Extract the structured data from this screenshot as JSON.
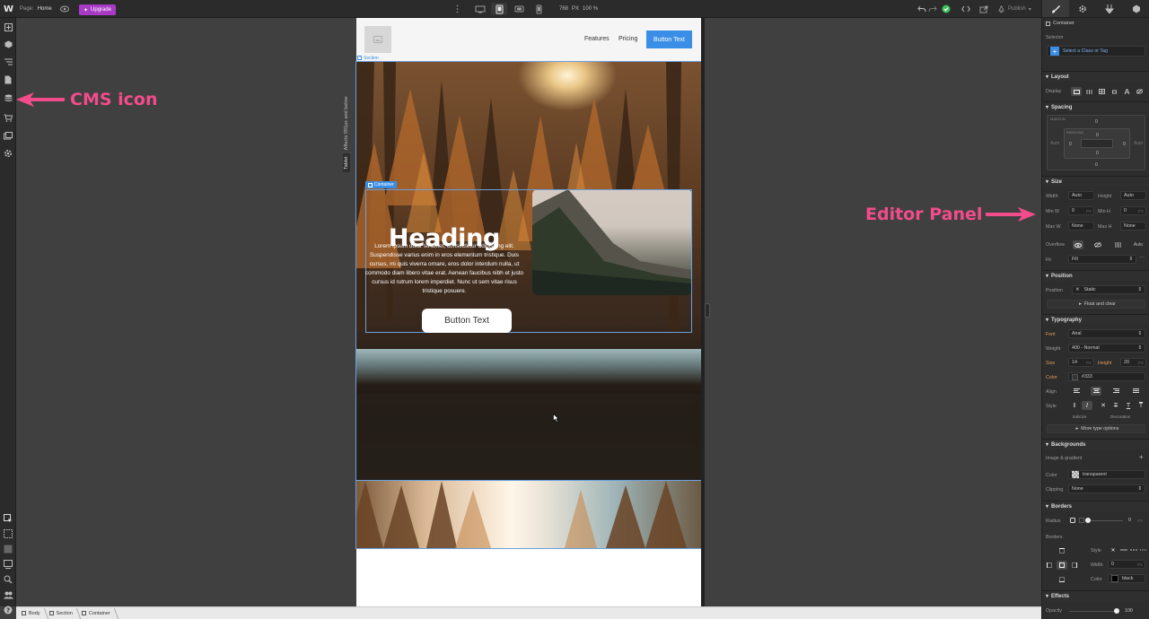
{
  "topbar": {
    "logo": "W",
    "page_label": "Page:",
    "page_value": "Home",
    "upgrade_label": "Upgrade",
    "width_readout": "768",
    "width_unit": "PX",
    "zoom_readout": "100 %",
    "publish_label": "Publish"
  },
  "canvas": {
    "breakpoint_note": "Affects 991px and below",
    "breakpoint_tag": "Tablet",
    "site": {
      "nav_links": [
        "Features",
        "Pricing"
      ],
      "nav_button": "Button Text",
      "section_tag": "Section",
      "container_tag": "Container",
      "heading": "Heading",
      "paragraph": "Lorem ipsum dolor sit amet, consectetur adipiscing elit. Suspendisse varius enim in eros elementum tristique. Duis cursus, mi quis viverra ornare, eros dolor interdum nulla, ut commodo diam libero vitae erat. Aenean faucibus nibh et justo cursus id rutrum lorem imperdiet. Nunc ut sem vitae risus tristique posuere.",
      "hero_button": "Button Text"
    },
    "callout_cms": "CMS icon",
    "callout_panel": "Editor Panel"
  },
  "panel": {
    "element_name": "Container",
    "selector_label": "Selector",
    "selector_placeholder": "Select a Class or Tag",
    "layout": {
      "title": "Layout",
      "display_label": "Display"
    },
    "spacing": {
      "title": "Spacing",
      "margin_label": "MARGIN",
      "padding_label": "PADDING",
      "margin_top": "0",
      "margin_bottom": "0",
      "margin_left": "Auto",
      "margin_right": "Auto",
      "pad_top": "0",
      "pad_bottom": "0",
      "pad_left": "0",
      "pad_right": "0"
    },
    "size": {
      "title": "Size",
      "width_label": "Width",
      "width_value": "Auto",
      "height_label": "Height",
      "height_value": "Auto",
      "minw_label": "Min W",
      "minw_value": "0",
      "minw_unit": "PX",
      "minh_label": "Min H",
      "minh_value": "0",
      "minh_unit": "PX",
      "maxw_label": "Max W",
      "maxw_value": "None",
      "maxh_label": "Max H",
      "maxh_value": "None",
      "overflow_label": "Overflow",
      "overflow_auto": "Auto",
      "fit_label": "Fit",
      "fit_value": "Fill"
    },
    "position": {
      "title": "Position",
      "label": "Position",
      "value": "Static",
      "float_label": "Float and clear"
    },
    "typography": {
      "title": "Typography",
      "font_label": "Font",
      "font_value": "Arial",
      "weight_label": "Weight",
      "weight_value": "400 - Normal",
      "size_label": "Size",
      "size_value": "14",
      "size_unit": "PX",
      "height_label": "Height",
      "height_value": "20",
      "height_unit": "PX",
      "color_label": "Color",
      "color_value": "#333",
      "align_label": "Align",
      "style_label": "Style",
      "italicize_label": "Italicize",
      "decoration_label": "Decoration",
      "more_label": "More type options"
    },
    "backgrounds": {
      "title": "Backgrounds",
      "image_label": "Image & gradient",
      "color_label": "Color",
      "color_value": "transparent",
      "clipping_label": "Clipping",
      "clipping_value": "None"
    },
    "borders": {
      "title": "Borders",
      "radius_label": "Radius",
      "radius_value": "0",
      "radius_unit": "PX",
      "borders_label": "Borders",
      "style_label": "Style",
      "width_label": "Width",
      "width_value": "0",
      "width_unit": "PX",
      "color_label": "Color",
      "color_value": "black"
    },
    "effects": {
      "title": "Effects",
      "opacity_label": "Opacity",
      "opacity_value": "100"
    }
  },
  "breadcrumb": [
    "Body",
    "Section",
    "Container"
  ],
  "colors": {
    "accent": "#3a8ee6",
    "upgrade": "#a93ac6",
    "callout": "#f24c8a",
    "status_ok": "#3fbf5a"
  }
}
